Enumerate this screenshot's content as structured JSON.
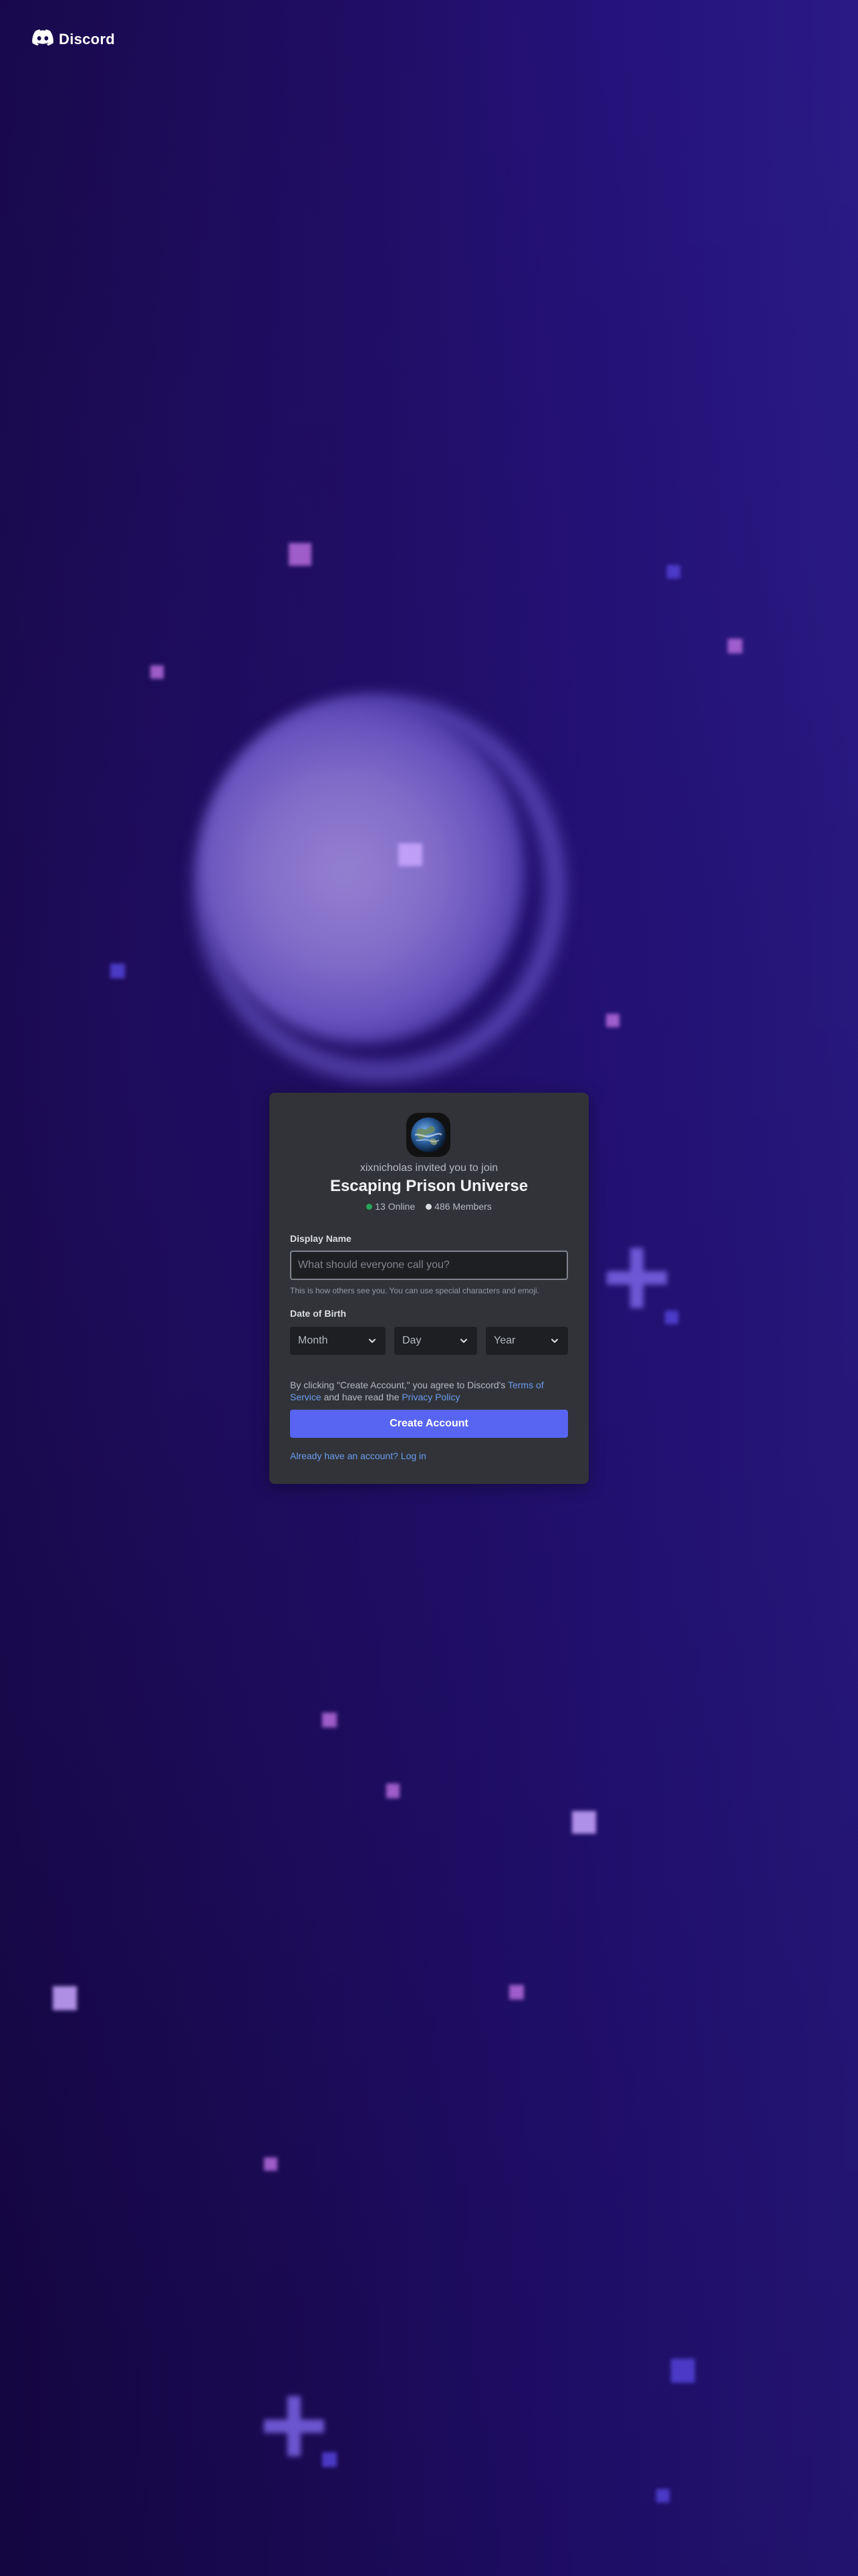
{
  "brand": {
    "name": "Discord"
  },
  "invite": {
    "inviter_text": "xixnicholas invited you to join",
    "server_name": "Escaping Prison Universe",
    "online": "13 Online",
    "members": "486 Members"
  },
  "form": {
    "display_name": {
      "label": "Display Name",
      "placeholder": "What should everyone call you?",
      "value": "",
      "help": "This is how others see you. You can use special characters and emoji."
    },
    "dob": {
      "label": "Date of Birth",
      "month": "Month",
      "day": "Day",
      "year": "Year"
    },
    "legal": {
      "prefix": "By clicking \"Create Account,\" you agree to Discord's ",
      "tos": "Terms of Service",
      "middle": " and have read the ",
      "privacy": "Privacy Policy"
    },
    "submit": "Create Account",
    "login_link": "Already have an account? Log in"
  },
  "colors": {
    "background": "#1f0d62",
    "card": "#313338",
    "input_bg": "#1e1f22",
    "accent": "#5865f2",
    "link": "#6b9cf0",
    "online": "#23a55a"
  }
}
